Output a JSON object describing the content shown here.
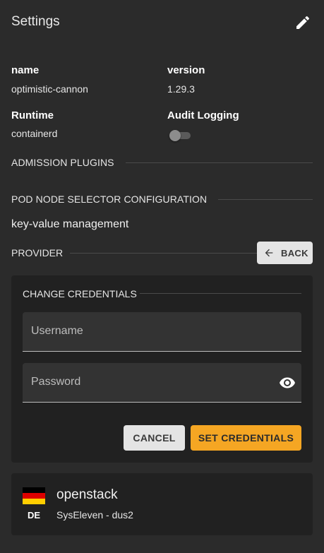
{
  "header": {
    "title": "Settings",
    "edit_icon": "pencil-icon"
  },
  "fields": {
    "name_label": "name",
    "name_value": "optimistic-cannon",
    "version_label": "version",
    "version_value": "1.29.3",
    "runtime_label": "Runtime",
    "runtime_value": "containerd",
    "audit_label": "Audit Logging",
    "audit_enabled": false
  },
  "sections": {
    "admission_plugins": "ADMISSION PLUGINS",
    "pod_node_selector": "POD NODE SELECTOR CONFIGURATION",
    "kv_management": "key-value management",
    "provider": "PROVIDER",
    "back_label": "BACK"
  },
  "credentials": {
    "title": "CHANGE CREDENTIALS",
    "username_placeholder": "Username",
    "password_placeholder": "Password",
    "cancel_label": "CANCEL",
    "set_label": "SET CREDENTIALS"
  },
  "provider": {
    "name": "openstack",
    "region": "SysEleven - dus2",
    "country_code": "DE",
    "flag_colors": [
      "#000000",
      "#dd0000",
      "#ffce00"
    ]
  },
  "colors": {
    "accent": "#f5a623",
    "background": "#2b2b2b",
    "card": "#212121"
  }
}
